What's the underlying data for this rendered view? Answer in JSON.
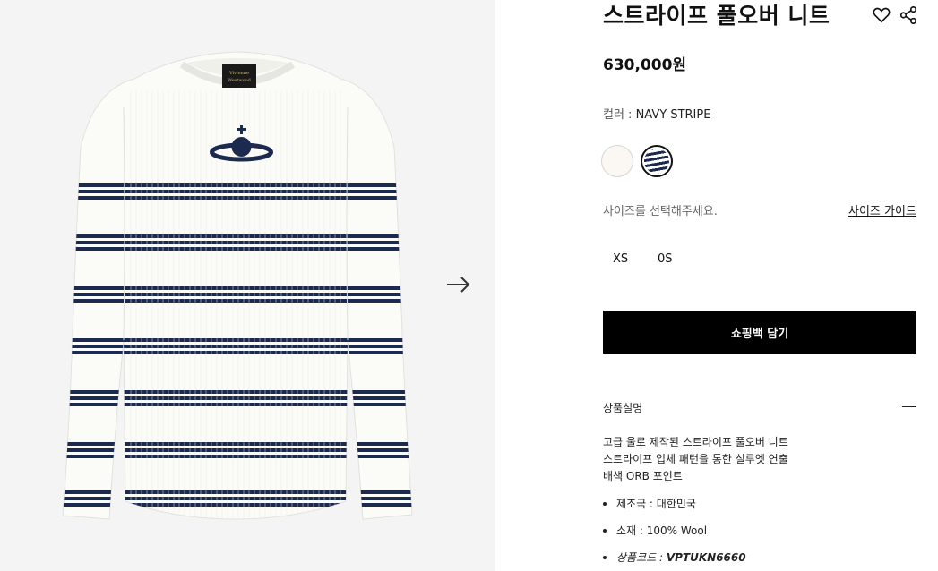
{
  "product": {
    "title": "스트라이프 풀오버 니트",
    "price": "630,000원"
  },
  "icons": {
    "favorite": "heart-icon",
    "share": "share-icon",
    "next": "arrow-right-icon",
    "collapse": "minus-icon"
  },
  "color": {
    "label": "컬러 : ",
    "value": "NAVY STRIPE",
    "swatches": [
      {
        "name": "ivory",
        "hex": "#fbf7f3"
      },
      {
        "name": "navy stripe",
        "hex": "#1d2a4f",
        "selected": true
      }
    ]
  },
  "size": {
    "prompt": "사이즈를 선택해주세요.",
    "guide_label": "사이즈 가이드",
    "options": [
      "XS",
      "0S"
    ]
  },
  "cta": {
    "add_to_bag": "쇼핑백 담기"
  },
  "description": {
    "heading": "상품설명",
    "lines": [
      "고급 울로 제작된 스트라이프 풀오버 니트",
      "스트라이프 입체 패턴을 통한 실루엣 연출",
      "배색 ORB 포인트"
    ],
    "bullets": [
      {
        "label": "제조국 : ",
        "value": "대한민국"
      },
      {
        "label": "소재 : ",
        "value": "100% Wool"
      },
      {
        "label": "상품코드 : ",
        "value": "VPTUKN6660"
      }
    ]
  },
  "brand_label_text": "Vivienne Westwood"
}
